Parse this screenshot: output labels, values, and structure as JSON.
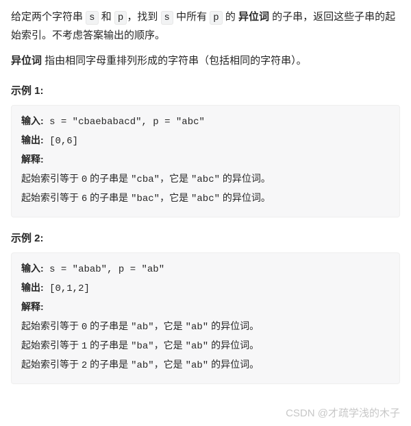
{
  "intro": {
    "pre_s": "给定两个字符串 ",
    "s_code": "s",
    "mid1": " 和 ",
    "p_code": "p",
    "mid2": "，找到 ",
    "s_code2": "s",
    "mid3": " 中所有 ",
    "p_code2": "p",
    "mid4": " 的 ",
    "anagram_bold": "异位词",
    "tail": " 的子串，返回这些子串的起始索引。不考虑答案输出的顺序。"
  },
  "definition": {
    "term": "异位词",
    "rest": " 指由相同字母重排列形成的字符串（包括相同的字符串）。"
  },
  "example1": {
    "title": "示例 1:",
    "input_label": "输入:",
    "input_value": " s = \"cbaebabacd\", p = \"abc\"",
    "output_label": "输出:",
    "output_value": " [0,6]",
    "explain_label": "解释:",
    "lines": [
      {
        "p1": "起始索引等于 ",
        "idx": "0",
        "p2": " 的子串是 ",
        "sub": "\"cba\"",
        "p3": "，它是 ",
        "pat": "\"abc\"",
        "p4": " 的异位词。"
      },
      {
        "p1": "起始索引等于 ",
        "idx": "6",
        "p2": " 的子串是 ",
        "sub": "\"bac\"",
        "p3": "，它是 ",
        "pat": "\"abc\"",
        "p4": " 的异位词。"
      }
    ]
  },
  "example2": {
    "title": "示例 2:",
    "input_label": "输入:",
    "input_value": " s = \"abab\", p = \"ab\"",
    "output_label": "输出:",
    "output_value": " [0,1,2]",
    "explain_label": "解释:",
    "lines": [
      {
        "p1": "起始索引等于 ",
        "idx": "0",
        "p2": " 的子串是 ",
        "sub": "\"ab\"",
        "p3": "，它是 ",
        "pat": "\"ab\"",
        "p4": " 的异位词。"
      },
      {
        "p1": "起始索引等于 ",
        "idx": "1",
        "p2": " 的子串是 ",
        "sub": "\"ba\"",
        "p3": "，它是 ",
        "pat": "\"ab\"",
        "p4": " 的异位词。"
      },
      {
        "p1": "起始索引等于 ",
        "idx": "2",
        "p2": " 的子串是 ",
        "sub": "\"ab\"",
        "p3": "，它是 ",
        "pat": "\"ab\"",
        "p4": " 的异位词。"
      }
    ]
  },
  "watermark": "CSDN @才疏学浅的木子"
}
